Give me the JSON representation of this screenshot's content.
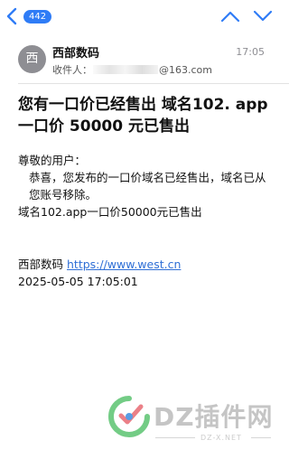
{
  "nav": {
    "unread_count": "442"
  },
  "message": {
    "avatar_initial": "西",
    "sender": "西部数码",
    "time": "17:05",
    "recipient_label": "收件人：",
    "recipient_domain": "@163.com",
    "subject": "您有一口价已经售出 域名102. app一口价 50000 元已售出",
    "body": {
      "greeting": "尊敬的用户：",
      "line1": "恭喜，您发布的一口价域名已经售出，域名已从您账号移除。",
      "line2": "域名102.app一口价50000元已售出"
    },
    "signature": {
      "company": "西部数码",
      "link": "https://www.west.cn",
      "datetime": "2025-05-05 17:05:01"
    }
  },
  "watermark": {
    "brand": "DZ插件网",
    "url": "DZ-X.NET"
  },
  "colors": {
    "badge": "#2f7cf6",
    "link": "#2f6fd6",
    "nav_icon": "#2f7cf6"
  }
}
